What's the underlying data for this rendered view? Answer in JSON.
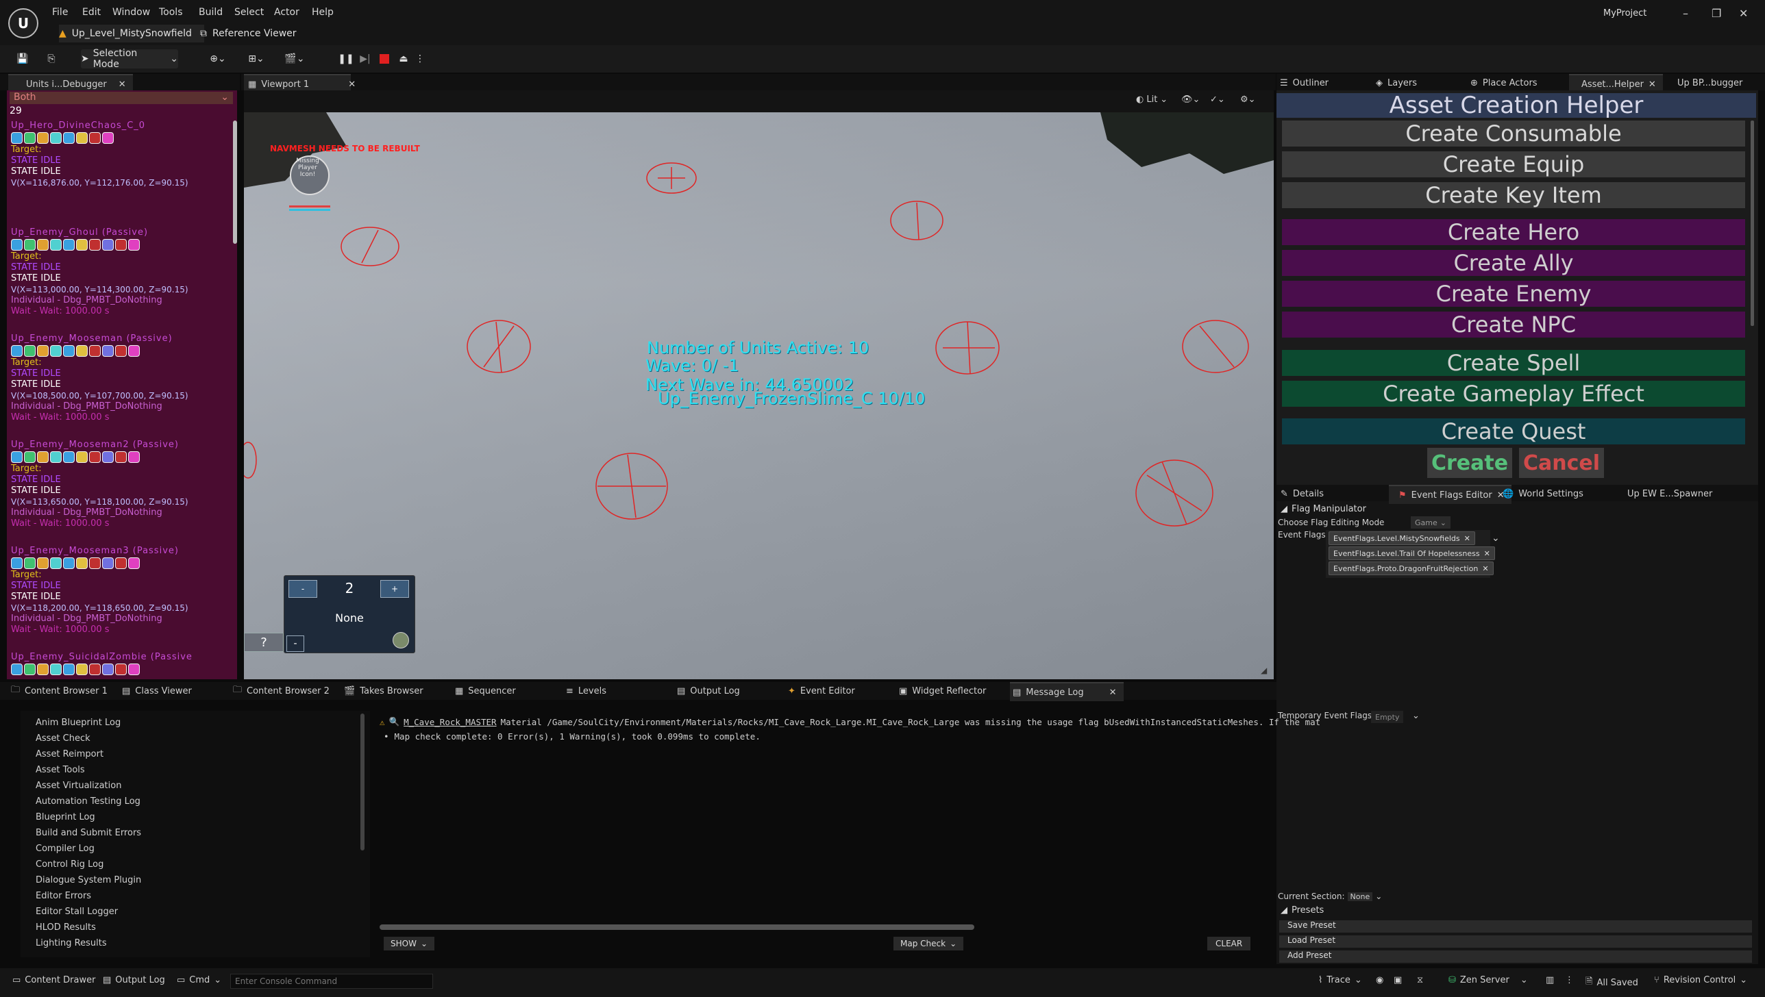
{
  "window": {
    "project": "MyProject",
    "doc_tab": "Up_Level_MistySnowfield",
    "ref_viewer": "Reference Viewer"
  },
  "menu": [
    "File",
    "Edit",
    "Window",
    "Tools",
    "Build",
    "Select",
    "Actor",
    "Help"
  ],
  "toolbar": {
    "mode": "Selection Mode"
  },
  "left_tab": "Units i...Debugger",
  "viewport_tab": "Viewport 1",
  "debugger": {
    "filter": "Both",
    "count": "29",
    "units": [
      {
        "name": "Up_Hero_DivineChaos_C_0",
        "target": "Target:",
        "state1": "STATE IDLE",
        "state2": "STATE IDLE",
        "coord": "V(X=116,876.00, Y=112,176.00, Z=90.15)",
        "indiv": "",
        "wait": ""
      },
      {
        "name": "Up_Enemy_Ghoul (Passive)",
        "target": "Target:",
        "state1": "STATE IDLE",
        "state2": "STATE IDLE",
        "coord": "V(X=113,000.00, Y=114,300.00, Z=90.15)",
        "indiv": "Individual - Dbg_PMBT_DoNothing",
        "wait": "Wait - Wait: 1000.00 s"
      },
      {
        "name": "Up_Enemy_Mooseman (Passive)",
        "target": "Target:",
        "state1": "STATE IDLE",
        "state2": "STATE IDLE",
        "coord": "V(X=108,500.00, Y=107,700.00, Z=90.15)",
        "indiv": "Individual - Dbg_PMBT_DoNothing",
        "wait": "Wait - Wait: 1000.00 s"
      },
      {
        "name": "Up_Enemy_Mooseman2 (Passive)",
        "target": "Target:",
        "state1": "STATE IDLE",
        "state2": "STATE IDLE",
        "coord": "V(X=113,650.00, Y=118,100.00, Z=90.15)",
        "indiv": "Individual - Dbg_PMBT_DoNothing",
        "wait": "Wait - Wait: 1000.00 s"
      },
      {
        "name": "Up_Enemy_Mooseman3 (Passive)",
        "target": "Target:",
        "state1": "STATE IDLE",
        "state2": "STATE IDLE",
        "coord": "V(X=118,200.00, Y=118,650.00, Z=90.15)",
        "indiv": "Individual - Dbg_PMBT_DoNothing",
        "wait": "Wait - Wait: 1000.00 s"
      },
      {
        "name": "Up_Enemy_SuicidalZombie (Passive",
        "target": "",
        "state1": "",
        "state2": "",
        "coord": "",
        "indiv": "",
        "wait": ""
      }
    ]
  },
  "viewport": {
    "lit": "Lit",
    "navmesh_warning": "NAVMESH NEEDS TO BE REBUILT",
    "player_label": "Missing Player Icon!",
    "hud_units": "Number of Units Active: 10",
    "hud_wave": "Wave: 0/ -1",
    "hud_next": "Next Wave in: 44.650002",
    "hud_frozen": "Up_Enemy_FrozenSlime_C 10/10",
    "widget_value": "2",
    "widget_none": "None",
    "widget_minus": "-",
    "widget_plus": "+",
    "widget_q": "?",
    "widget_small": "-"
  },
  "right_tabs": [
    "Outliner",
    "Layers",
    "Place Actors",
    "Asset...Helper",
    "Up BP...bugger"
  ],
  "asset_helper": {
    "title": "Asset Creation Helper",
    "buttons_grey": [
      "Create Consumable",
      "Create Equip",
      "Create Key Item"
    ],
    "buttons_purple": [
      "Create Hero",
      "Create Ally",
      "Create Enemy",
      "Create NPC"
    ],
    "buttons_green": [
      "Create Spell",
      "Create Gameplay Effect"
    ],
    "button_teal": "Create Quest",
    "create": "Create",
    "cancel": "Cancel"
  },
  "details_tabs": [
    "Details",
    "Event Flags Editor",
    "World Settings",
    "Up EW E...Spawner"
  ],
  "flags": {
    "section": "Flag Manipulator",
    "mode_label": "Choose Flag Editing Mode",
    "mode_value": "Game",
    "event_flags_label": "Event Flags",
    "chips": [
      "EventFlags.Level.MistySnowfields",
      "EventFlags.Level.Trail Of Hopelessness",
      "EventFlags.Proto.DragonFruitRejection"
    ],
    "temp_label": "Temporary Event Flags",
    "temp_value": "Empty",
    "current_label": "Current Section:",
    "current_value": "None",
    "presets": "Presets",
    "preset_buttons": [
      "Save Preset",
      "Load Preset",
      "Add Preset"
    ]
  },
  "bottom_tabs": [
    "Content Browser 1",
    "Class Viewer",
    "Content Browser 2",
    "Takes Browser",
    "Sequencer",
    "Levels",
    "Output Log",
    "Event Editor",
    "Widget Reflector",
    "Message Log"
  ],
  "log_categories": [
    "Anim Blueprint Log",
    "Asset Check",
    "Asset Reimport",
    "Asset Tools",
    "Asset Virtualization",
    "Automation Testing Log",
    "Blueprint Log",
    "Build and Submit Errors",
    "Compiler Log",
    "Control Rig Log",
    "Dialogue System Plugin",
    "Editor Errors",
    "Editor Stall Logger",
    "HLOD Results",
    "Lighting Results"
  ],
  "log": {
    "line1_link": "M_Cave_Rock_MASTER",
    "line1": "Material /Game/SoulCity/Environment/Materials/Rocks/MI_Cave_Rock_Large.MI_Cave_Rock_Large was missing the usage flag bUsedWithInstancedStaticMeshes. If the mat",
    "line2": "Map check complete: 0 Error(s), 1 Warning(s), took 0.099ms to complete.",
    "show": "SHOW",
    "map_check": "Map Check",
    "clear": "CLEAR"
  },
  "status": {
    "content_drawer": "Content Drawer",
    "output_log": "Output Log",
    "cmd": "Cmd",
    "console_placeholder": "Enter Console Command",
    "trace": "Trace",
    "zen": "Zen Server",
    "saved": "All Saved",
    "revision": "Revision Control"
  },
  "colors": {
    "hud": "#2fe0f0",
    "debug_bg": "#4a0c30",
    "purple_btn": "#4a0d4c",
    "green_btn": "#0c4a30"
  }
}
